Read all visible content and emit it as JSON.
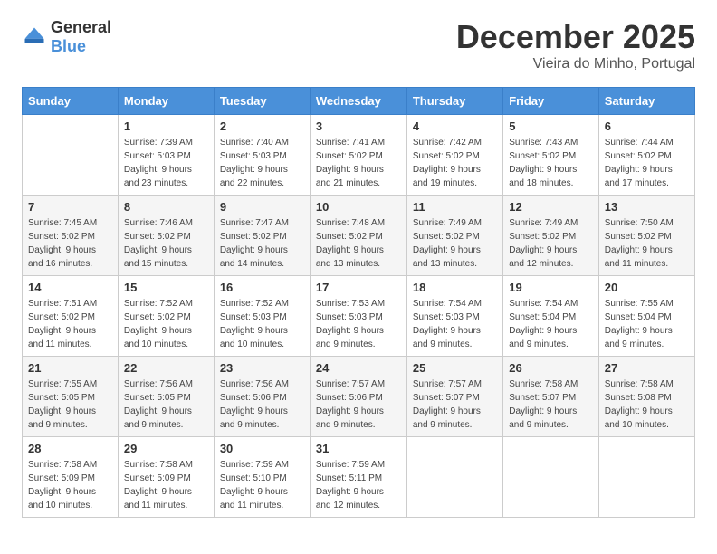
{
  "logo": {
    "text_general": "General",
    "text_blue": "Blue"
  },
  "title": {
    "month": "December 2025",
    "location": "Vieira do Minho, Portugal"
  },
  "headers": [
    "Sunday",
    "Monday",
    "Tuesday",
    "Wednesday",
    "Thursday",
    "Friday",
    "Saturday"
  ],
  "weeks": [
    [
      {
        "day": "",
        "sunrise": "",
        "sunset": "",
        "daylight": ""
      },
      {
        "day": "1",
        "sunrise": "Sunrise: 7:39 AM",
        "sunset": "Sunset: 5:03 PM",
        "daylight": "Daylight: 9 hours and 23 minutes."
      },
      {
        "day": "2",
        "sunrise": "Sunrise: 7:40 AM",
        "sunset": "Sunset: 5:03 PM",
        "daylight": "Daylight: 9 hours and 22 minutes."
      },
      {
        "day": "3",
        "sunrise": "Sunrise: 7:41 AM",
        "sunset": "Sunset: 5:02 PM",
        "daylight": "Daylight: 9 hours and 21 minutes."
      },
      {
        "day": "4",
        "sunrise": "Sunrise: 7:42 AM",
        "sunset": "Sunset: 5:02 PM",
        "daylight": "Daylight: 9 hours and 19 minutes."
      },
      {
        "day": "5",
        "sunrise": "Sunrise: 7:43 AM",
        "sunset": "Sunset: 5:02 PM",
        "daylight": "Daylight: 9 hours and 18 minutes."
      },
      {
        "day": "6",
        "sunrise": "Sunrise: 7:44 AM",
        "sunset": "Sunset: 5:02 PM",
        "daylight": "Daylight: 9 hours and 17 minutes."
      }
    ],
    [
      {
        "day": "7",
        "sunrise": "Sunrise: 7:45 AM",
        "sunset": "Sunset: 5:02 PM",
        "daylight": "Daylight: 9 hours and 16 minutes."
      },
      {
        "day": "8",
        "sunrise": "Sunrise: 7:46 AM",
        "sunset": "Sunset: 5:02 PM",
        "daylight": "Daylight: 9 hours and 15 minutes."
      },
      {
        "day": "9",
        "sunrise": "Sunrise: 7:47 AM",
        "sunset": "Sunset: 5:02 PM",
        "daylight": "Daylight: 9 hours and 14 minutes."
      },
      {
        "day": "10",
        "sunrise": "Sunrise: 7:48 AM",
        "sunset": "Sunset: 5:02 PM",
        "daylight": "Daylight: 9 hours and 13 minutes."
      },
      {
        "day": "11",
        "sunrise": "Sunrise: 7:49 AM",
        "sunset": "Sunset: 5:02 PM",
        "daylight": "Daylight: 9 hours and 13 minutes."
      },
      {
        "day": "12",
        "sunrise": "Sunrise: 7:49 AM",
        "sunset": "Sunset: 5:02 PM",
        "daylight": "Daylight: 9 hours and 12 minutes."
      },
      {
        "day": "13",
        "sunrise": "Sunrise: 7:50 AM",
        "sunset": "Sunset: 5:02 PM",
        "daylight": "Daylight: 9 hours and 11 minutes."
      }
    ],
    [
      {
        "day": "14",
        "sunrise": "Sunrise: 7:51 AM",
        "sunset": "Sunset: 5:02 PM",
        "daylight": "Daylight: 9 hours and 11 minutes."
      },
      {
        "day": "15",
        "sunrise": "Sunrise: 7:52 AM",
        "sunset": "Sunset: 5:02 PM",
        "daylight": "Daylight: 9 hours and 10 minutes."
      },
      {
        "day": "16",
        "sunrise": "Sunrise: 7:52 AM",
        "sunset": "Sunset: 5:03 PM",
        "daylight": "Daylight: 9 hours and 10 minutes."
      },
      {
        "day": "17",
        "sunrise": "Sunrise: 7:53 AM",
        "sunset": "Sunset: 5:03 PM",
        "daylight": "Daylight: 9 hours and 9 minutes."
      },
      {
        "day": "18",
        "sunrise": "Sunrise: 7:54 AM",
        "sunset": "Sunset: 5:03 PM",
        "daylight": "Daylight: 9 hours and 9 minutes."
      },
      {
        "day": "19",
        "sunrise": "Sunrise: 7:54 AM",
        "sunset": "Sunset: 5:04 PM",
        "daylight": "Daylight: 9 hours and 9 minutes."
      },
      {
        "day": "20",
        "sunrise": "Sunrise: 7:55 AM",
        "sunset": "Sunset: 5:04 PM",
        "daylight": "Daylight: 9 hours and 9 minutes."
      }
    ],
    [
      {
        "day": "21",
        "sunrise": "Sunrise: 7:55 AM",
        "sunset": "Sunset: 5:05 PM",
        "daylight": "Daylight: 9 hours and 9 minutes."
      },
      {
        "day": "22",
        "sunrise": "Sunrise: 7:56 AM",
        "sunset": "Sunset: 5:05 PM",
        "daylight": "Daylight: 9 hours and 9 minutes."
      },
      {
        "day": "23",
        "sunrise": "Sunrise: 7:56 AM",
        "sunset": "Sunset: 5:06 PM",
        "daylight": "Daylight: 9 hours and 9 minutes."
      },
      {
        "day": "24",
        "sunrise": "Sunrise: 7:57 AM",
        "sunset": "Sunset: 5:06 PM",
        "daylight": "Daylight: 9 hours and 9 minutes."
      },
      {
        "day": "25",
        "sunrise": "Sunrise: 7:57 AM",
        "sunset": "Sunset: 5:07 PM",
        "daylight": "Daylight: 9 hours and 9 minutes."
      },
      {
        "day": "26",
        "sunrise": "Sunrise: 7:58 AM",
        "sunset": "Sunset: 5:07 PM",
        "daylight": "Daylight: 9 hours and 9 minutes."
      },
      {
        "day": "27",
        "sunrise": "Sunrise: 7:58 AM",
        "sunset": "Sunset: 5:08 PM",
        "daylight": "Daylight: 9 hours and 10 minutes."
      }
    ],
    [
      {
        "day": "28",
        "sunrise": "Sunrise: 7:58 AM",
        "sunset": "Sunset: 5:09 PM",
        "daylight": "Daylight: 9 hours and 10 minutes."
      },
      {
        "day": "29",
        "sunrise": "Sunrise: 7:58 AM",
        "sunset": "Sunset: 5:09 PM",
        "daylight": "Daylight: 9 hours and 11 minutes."
      },
      {
        "day": "30",
        "sunrise": "Sunrise: 7:59 AM",
        "sunset": "Sunset: 5:10 PM",
        "daylight": "Daylight: 9 hours and 11 minutes."
      },
      {
        "day": "31",
        "sunrise": "Sunrise: 7:59 AM",
        "sunset": "Sunset: 5:11 PM",
        "daylight": "Daylight: 9 hours and 12 minutes."
      },
      {
        "day": "",
        "sunrise": "",
        "sunset": "",
        "daylight": ""
      },
      {
        "day": "",
        "sunrise": "",
        "sunset": "",
        "daylight": ""
      },
      {
        "day": "",
        "sunrise": "",
        "sunset": "",
        "daylight": ""
      }
    ]
  ]
}
